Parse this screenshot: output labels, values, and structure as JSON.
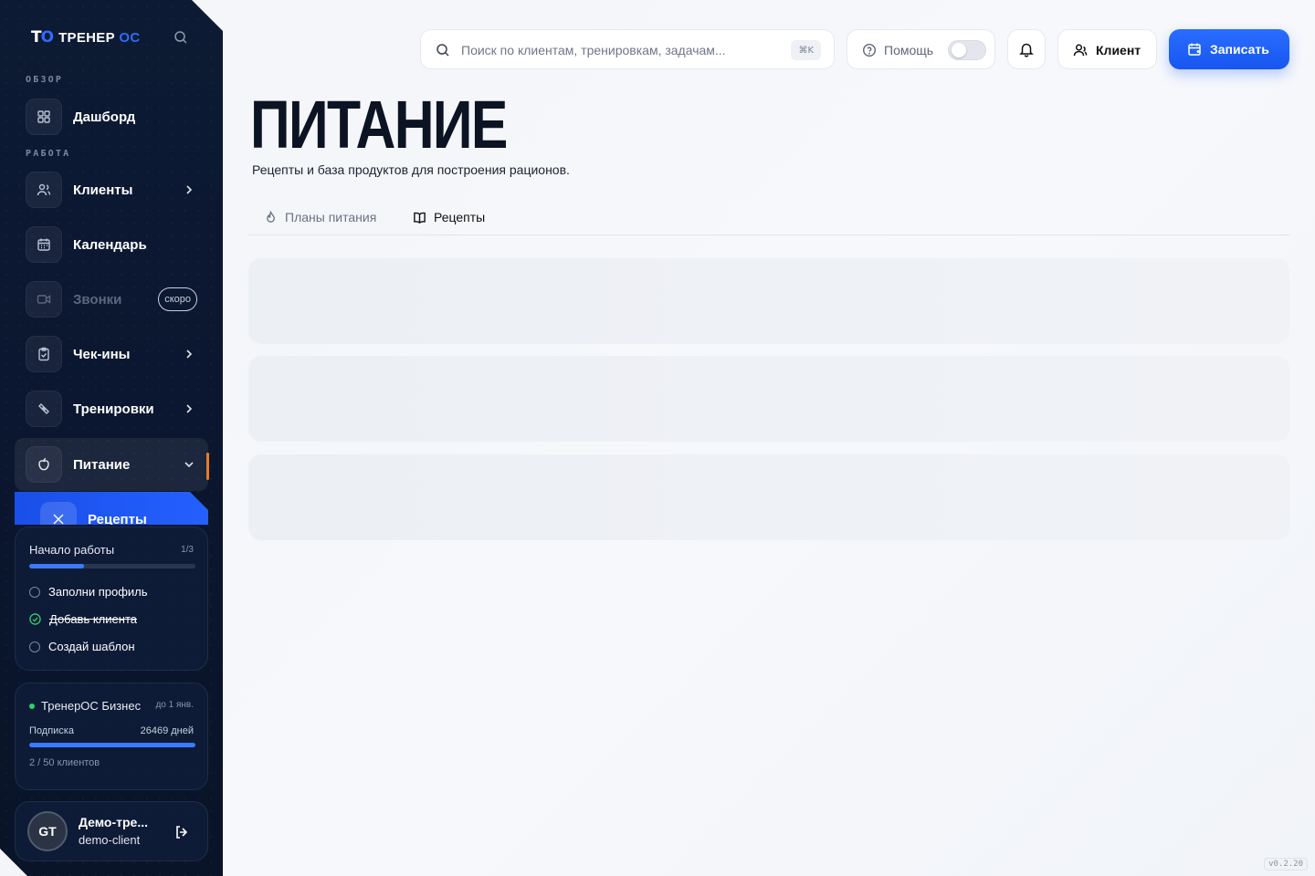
{
  "app": {
    "logo_mark_left": "T",
    "logo_mark_right": "O",
    "logo_word": "ТРЕНЕР",
    "logo_os": "ОС"
  },
  "sidebar": {
    "sections": [
      "ОБЗОР",
      "РАБОТА"
    ],
    "items": [
      {
        "label": "Дашборд",
        "icon": "grid-icon"
      },
      {
        "label": "Клиенты",
        "icon": "users-icon"
      },
      {
        "label": "Календарь",
        "icon": "calendar-icon"
      },
      {
        "label": "Звонки",
        "icon": "video-icon",
        "badge": "скоро"
      },
      {
        "label": "Чек-ины",
        "icon": "clipboard-check-icon"
      },
      {
        "label": "Тренировки",
        "icon": "dumbbell-icon"
      },
      {
        "label": "Питание",
        "icon": "apple-icon"
      },
      {
        "label": "Рецепты",
        "icon": "utensils-icon"
      }
    ],
    "onboarding": {
      "title": "Начало работы",
      "count": "1/3",
      "progress": 0.33,
      "tasks": [
        {
          "label": "Заполни профиль",
          "done": false
        },
        {
          "label": "Добавь клиента",
          "done": true
        },
        {
          "label": "Создай шаблон",
          "done": false
        }
      ]
    },
    "subscription": {
      "plan": "ТренерОС Бизнес",
      "until": "до 1 янв.",
      "label": "Подписка",
      "days": "26469 дней",
      "progress": 1.0,
      "clients": "2 / 50 клиентов"
    },
    "user": {
      "initials": "GT",
      "name": "Демо-тре...",
      "login": "demo-client"
    }
  },
  "header": {
    "search_placeholder": "Поиск по клиентам, тренировкам, задачам...",
    "search_shortcut": "⌘K",
    "help_label": "Помощь",
    "client_label": "Клиент",
    "primary_label": "Записать"
  },
  "main": {
    "title": "ПИТАНИЕ",
    "subtitle": "Рецепты и база продуктов для построения рационов.",
    "tabs": [
      {
        "label": "Планы питания",
        "icon": "flame-icon",
        "active": false
      },
      {
        "label": "Рецепты",
        "icon": "book-open-icon",
        "active": true
      }
    ]
  },
  "version": "v0.2.20",
  "colors": {
    "accent": "#2460ff",
    "sidebar_bg": "#0b1730",
    "active_marker": "#f07a22",
    "success": "#2fd06e"
  }
}
